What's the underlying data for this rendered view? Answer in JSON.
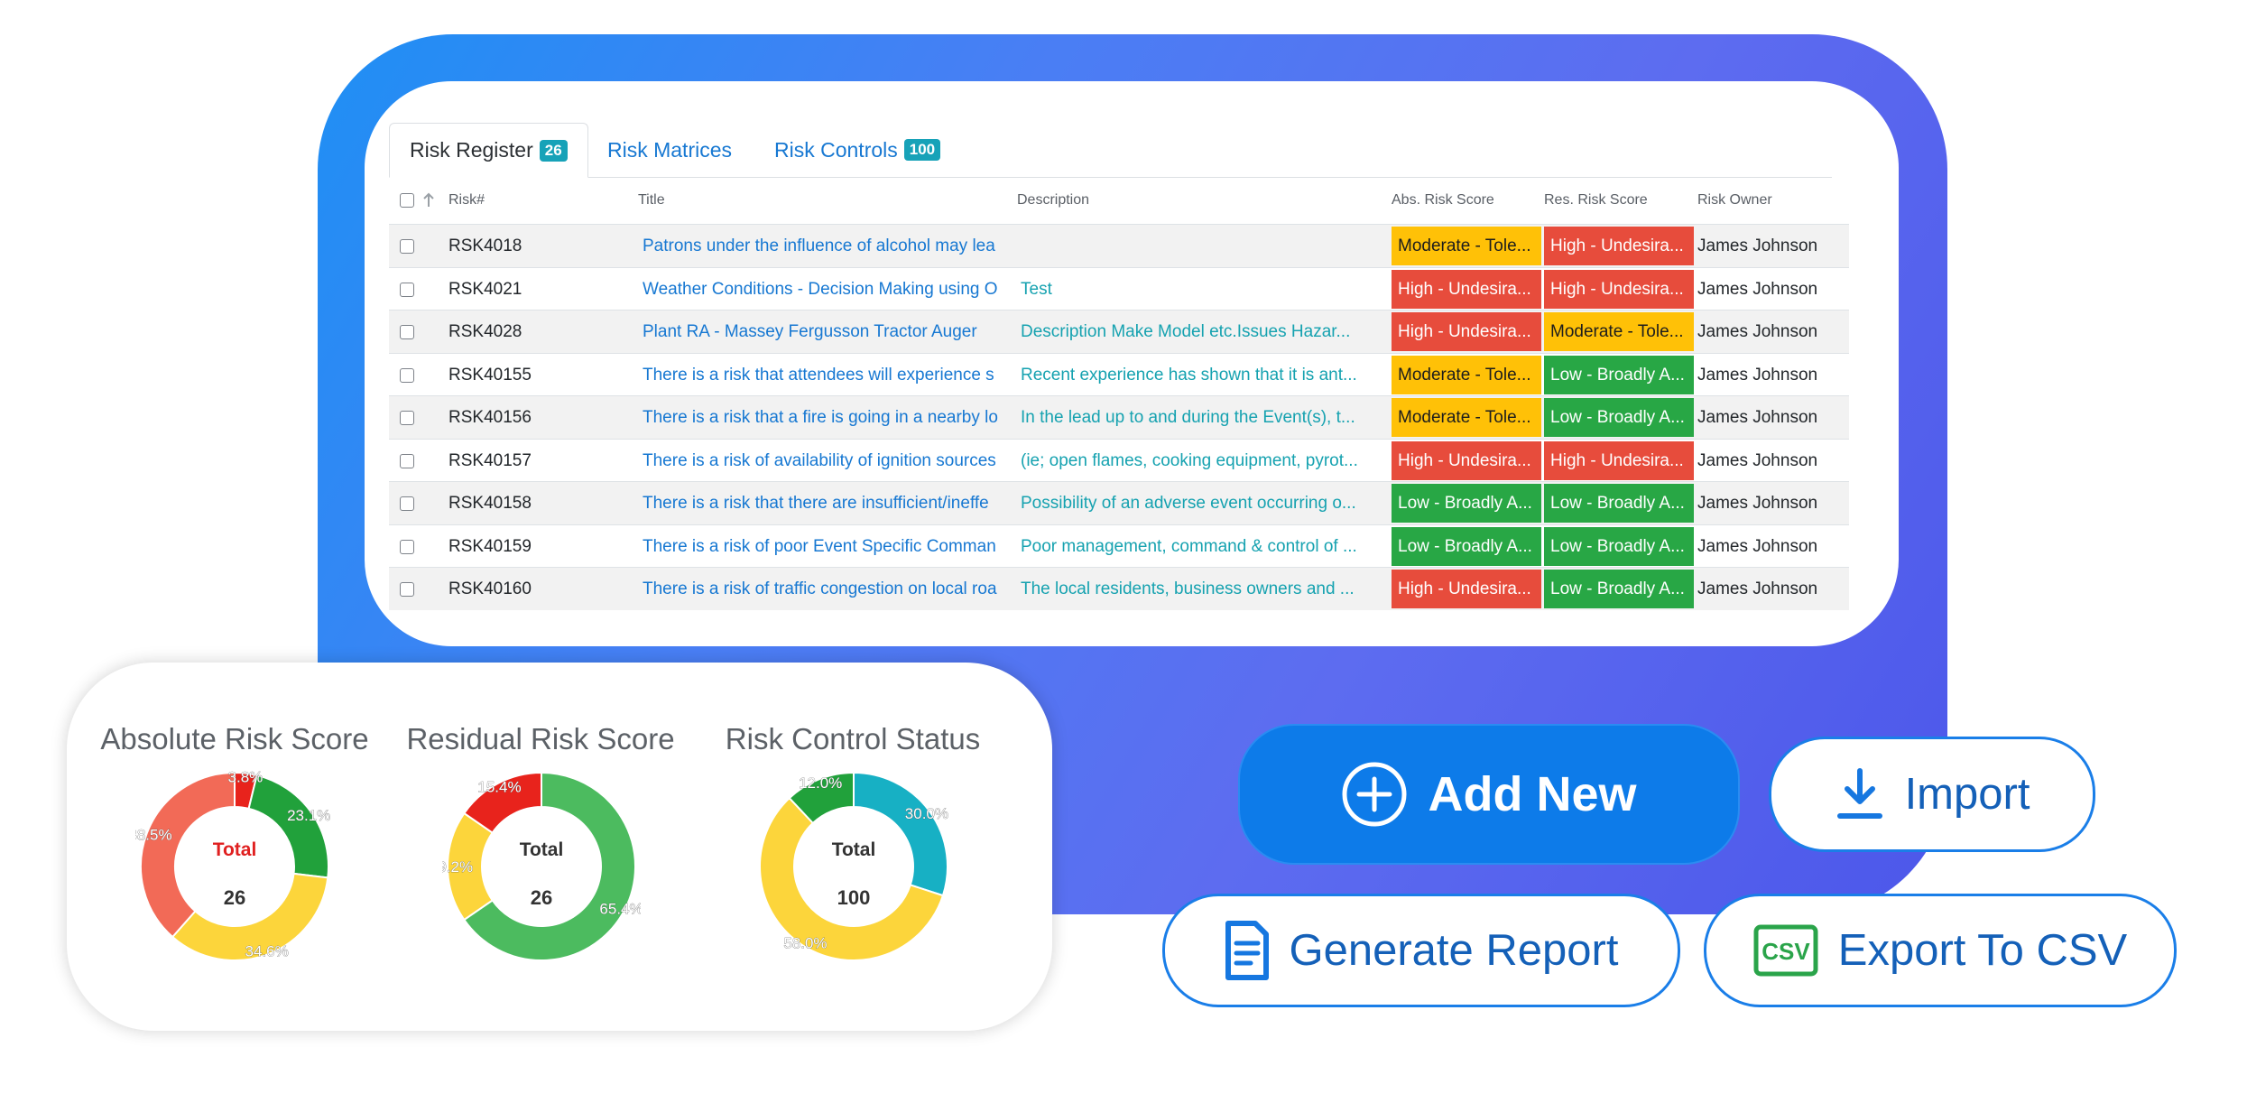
{
  "tabs": [
    {
      "label": "Risk Register",
      "badge": "26"
    },
    {
      "label": "Risk Matrices"
    },
    {
      "label": "Risk Controls",
      "badge": "100"
    }
  ],
  "table": {
    "headers": {
      "id": "Risk#",
      "title": "Title",
      "description": "Description",
      "abs": "Abs. Risk Score",
      "res": "Res. Risk Score",
      "owner": "Risk Owner"
    },
    "rows": [
      {
        "id": "RSK4018",
        "title": "Patrons under the influence of alcohol may lea",
        "description": "",
        "abs": "Moderate - Tole...",
        "abs_level": "moderate",
        "res": "High - Undesira...",
        "res_level": "high",
        "owner": "James Johnson"
      },
      {
        "id": "RSK4021",
        "title": "Weather Conditions - Decision Making using O",
        "description": "Test",
        "abs": "High - Undesira...",
        "abs_level": "high",
        "res": "High - Undesira...",
        "res_level": "high",
        "owner": "James Johnson"
      },
      {
        "id": "RSK4028",
        "title": "Plant RA - Massey Fergusson Tractor Auger",
        "description": "Description Make Model etc.Issues Hazar...",
        "abs": "High - Undesira...",
        "abs_level": "high",
        "res": "Moderate - Tole...",
        "res_level": "moderate",
        "owner": "James Johnson"
      },
      {
        "id": "RSK40155",
        "title": "There is a risk that attendees will experience s",
        "description": "Recent experience has shown that it is ant...",
        "abs": "Moderate - Tole...",
        "abs_level": "moderate",
        "res": "Low - Broadly A...",
        "res_level": "low",
        "owner": "James Johnson"
      },
      {
        "id": "RSK40156",
        "title": "There is a risk that a fire is going in a nearby lo",
        "description": "In the lead up to and during the Event(s), t...",
        "abs": "Moderate - Tole...",
        "abs_level": "moderate",
        "res": "Low - Broadly A...",
        "res_level": "low",
        "owner": "James Johnson"
      },
      {
        "id": "RSK40157",
        "title": "There is a risk of availability of ignition sources",
        "description": "(ie; open flames, cooking equipment, pyrot...",
        "abs": "High - Undesira...",
        "abs_level": "high",
        "res": "High - Undesira...",
        "res_level": "high",
        "owner": "James Johnson"
      },
      {
        "id": "RSK40158",
        "title": "There is a risk that there are insufficient/ineffe",
        "description": "Possibility of an adverse event occurring o...",
        "abs": "Low - Broadly A...",
        "abs_level": "low",
        "res": "Low - Broadly A...",
        "res_level": "low",
        "owner": "James Johnson"
      },
      {
        "id": "RSK40159",
        "title": "There is a risk of poor Event Specific Comman",
        "description": "Poor management, command & control of ...",
        "abs": "Low - Broadly A...",
        "abs_level": "low",
        "res": "Low - Broadly A...",
        "res_level": "low",
        "owner": "James Johnson"
      },
      {
        "id": "RSK40160",
        "title": "There is a risk of traffic congestion on local roa",
        "description": "The local residents, business owners and ...",
        "abs": "High - Undesira...",
        "abs_level": "high",
        "res": "Low - Broadly A...",
        "res_level": "low",
        "owner": "James Johnson"
      }
    ]
  },
  "colors": {
    "moderate": "#ffc107",
    "high": "#e74c3c",
    "low": "#28a745",
    "teal": "#17a2b8",
    "accent": "#0d7be9"
  },
  "chart_data": [
    {
      "type": "pie",
      "title": "Absolute Risk Score",
      "center_label": "Total",
      "center_label_color": "#e02020",
      "center_value": "26",
      "values": [
        3.8,
        23.1,
        34.6,
        38.5
      ],
      "labels": [
        "3.8%",
        "23.1%",
        "34.6%",
        "38.5%"
      ],
      "colors": [
        "#e8231c",
        "#21a13b",
        "#fcd53b",
        "#f26a57"
      ]
    },
    {
      "type": "pie",
      "title": "Residual Risk Score",
      "center_label": "Total",
      "center_label_color": "#333333",
      "center_value": "26",
      "values": [
        65.4,
        19.2,
        15.4
      ],
      "labels": [
        "65.4%",
        "19.2%",
        "15.4%"
      ],
      "colors": [
        "#4cbb5f",
        "#fcd53b",
        "#e8231c"
      ]
    },
    {
      "type": "pie",
      "title": "Risk Control Status",
      "center_label": "Total",
      "center_label_color": "#333333",
      "center_value": "100",
      "values": [
        30.0,
        58.0,
        12.0
      ],
      "labels": [
        "30.0%",
        "58.0%",
        "12.0%"
      ],
      "colors": [
        "#17b0c4",
        "#fcd53b",
        "#21a13b"
      ]
    }
  ],
  "buttons": {
    "add_new": "Add New",
    "import": "Import",
    "generate_report": "Generate Report",
    "export_csv": "Export To CSV",
    "csv_icon_text": "CSV"
  }
}
